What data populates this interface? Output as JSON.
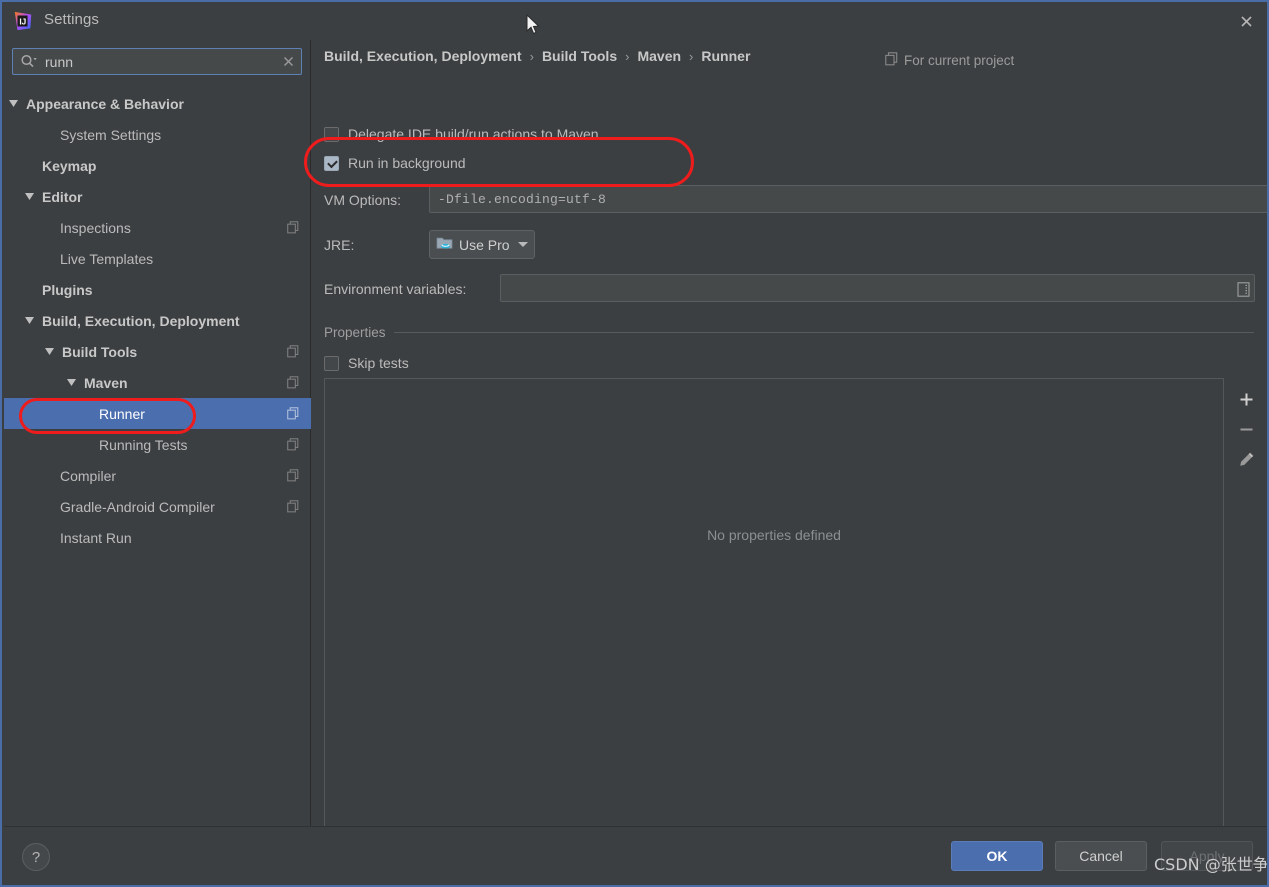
{
  "window": {
    "title": "Settings",
    "app_icon": "intellij-idea-logo-icon",
    "close_icon": "close-icon",
    "cursor_icon": "mouse-pointer-icon"
  },
  "search": {
    "value": "runn",
    "placeholder": "",
    "search_icon": "search-icon",
    "clear_icon": "clear-icon"
  },
  "sidebar": {
    "items": [
      {
        "label": "Appearance & Behavior",
        "indent": 22,
        "bold": true,
        "expanded": true,
        "arrow": "triangle-down-icon",
        "copy_icon": false,
        "selected": false
      },
      {
        "label": "System Settings",
        "indent": 56,
        "bold": false,
        "expanded": null,
        "arrow": "",
        "copy_icon": false,
        "selected": false
      },
      {
        "label": "Keymap",
        "indent": 38,
        "bold": true,
        "expanded": null,
        "arrow": "",
        "copy_icon": false,
        "selected": false
      },
      {
        "label": "Editor",
        "indent": 38,
        "bold": true,
        "expanded": true,
        "arrow": "triangle-down-icon",
        "copy_icon": false,
        "selected": false
      },
      {
        "label": "Inspections",
        "indent": 56,
        "bold": false,
        "expanded": null,
        "arrow": "",
        "copy_icon": true,
        "selected": false
      },
      {
        "label": "Live Templates",
        "indent": 56,
        "bold": false,
        "expanded": null,
        "arrow": "",
        "copy_icon": false,
        "selected": false
      },
      {
        "label": "Plugins",
        "indent": 38,
        "bold": true,
        "expanded": null,
        "arrow": "",
        "copy_icon": false,
        "selected": false
      },
      {
        "label": "Build, Execution, Deployment",
        "indent": 38,
        "bold": true,
        "expanded": true,
        "arrow": "triangle-down-icon",
        "copy_icon": false,
        "selected": false
      },
      {
        "label": "Build Tools",
        "indent": 58,
        "bold": true,
        "expanded": true,
        "arrow": "triangle-down-icon",
        "copy_icon": true,
        "selected": false
      },
      {
        "label": "Maven",
        "indent": 80,
        "bold": true,
        "expanded": true,
        "arrow": "triangle-down-icon",
        "copy_icon": true,
        "selected": false
      },
      {
        "label": "Runner",
        "indent": 95,
        "bold": false,
        "expanded": null,
        "arrow": "",
        "copy_icon": true,
        "selected": true
      },
      {
        "label": "Running Tests",
        "indent": 95,
        "bold": false,
        "expanded": null,
        "arrow": "",
        "copy_icon": true,
        "selected": false
      },
      {
        "label": "Compiler",
        "indent": 56,
        "bold": false,
        "expanded": null,
        "arrow": "",
        "copy_icon": true,
        "selected": false
      },
      {
        "label": "Gradle-Android Compiler",
        "indent": 56,
        "bold": false,
        "expanded": null,
        "arrow": "",
        "copy_icon": true,
        "selected": false
      },
      {
        "label": "Instant Run",
        "indent": 56,
        "bold": false,
        "expanded": null,
        "arrow": "",
        "copy_icon": false,
        "selected": false
      }
    ],
    "selection_color": "#4b6eaf"
  },
  "content": {
    "breadcrumb": [
      "Build, Execution, Deployment",
      "Build Tools",
      "Maven",
      "Runner"
    ],
    "breadcrumb_separator": "›",
    "for_current_project": {
      "label": "For current project",
      "icon": "copy-scope-icon"
    },
    "checkbox_delegate": {
      "label": "Delegate IDE build/run actions to Maven",
      "checked": false
    },
    "checkbox_run_background": {
      "label": "Run in background",
      "checked": true
    },
    "vm_options": {
      "label": "VM Options:",
      "value": "-Dfile.encoding=utf-8",
      "placeholder": "",
      "expand_icon": "expand-arrows-icon"
    },
    "jre": {
      "label": "JRE:",
      "selected": "Use Pro",
      "icon": "jdk-folder-icon",
      "caret_icon": "caret-down-icon"
    },
    "environment_variables": {
      "label": "Environment variables:",
      "value": "",
      "placeholder": "",
      "browse_icon": "list-browse-icon"
    },
    "properties_section": {
      "title": "Properties",
      "checkbox_skip_tests": {
        "label": "Skip tests",
        "checked": false
      },
      "empty_message": "No properties defined",
      "toolbar": [
        {
          "name": "add-property-button",
          "icon": "plus-icon"
        },
        {
          "name": "remove-property-button",
          "icon": "minus-icon"
        },
        {
          "name": "edit-property-button",
          "icon": "pencil-icon"
        }
      ]
    }
  },
  "footer": {
    "help_label": "?",
    "ok_label": "OK",
    "cancel_label": "Cancel",
    "apply_label": "Apply",
    "apply_enabled": false
  },
  "watermark": "CSDN @张世争",
  "colors": {
    "window_bg": "#3c3f41",
    "field_bg": "#45494a",
    "accent_blue": "#4b6eaf",
    "border_blue": "#4a6da7",
    "annotation_red": "#ee1c1c",
    "text_primary": "#bbbbbb",
    "text_muted": "#8c8f91"
  }
}
